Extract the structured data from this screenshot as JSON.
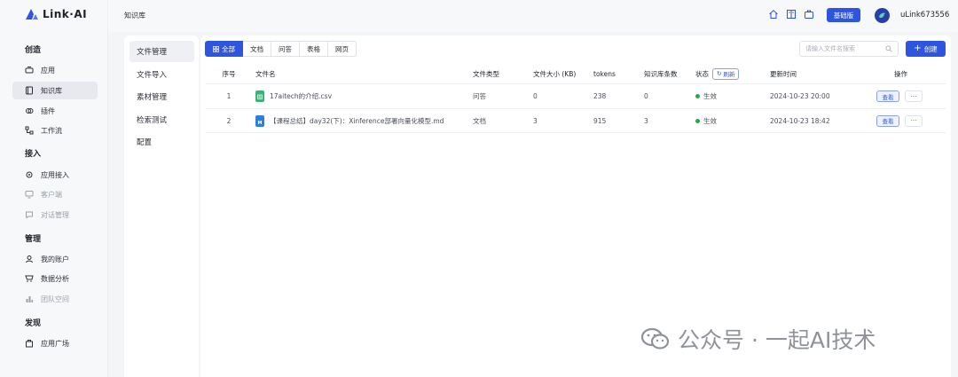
{
  "app": {
    "brand": "Link·AI"
  },
  "sidebar": {
    "groups": [
      {
        "title": "创造",
        "items": [
          {
            "label": "应用",
            "icon": "app-icon"
          },
          {
            "label": "知识库",
            "icon": "book-icon",
            "active": true
          },
          {
            "label": "插件",
            "icon": "plugin-icon"
          },
          {
            "label": "工作流",
            "icon": "workflow-icon"
          }
        ]
      },
      {
        "title": "接入",
        "items": [
          {
            "label": "应用接入",
            "icon": "access-icon"
          },
          {
            "label": "客户端",
            "icon": "monitor-icon",
            "muted": true
          },
          {
            "label": "对话管理",
            "icon": "chat-icon",
            "muted": true
          }
        ]
      },
      {
        "title": "管理",
        "items": [
          {
            "label": "我的账户",
            "icon": "user-icon"
          },
          {
            "label": "数据分析",
            "icon": "chart-icon"
          },
          {
            "label": "团队空间",
            "icon": "team-icon",
            "muted": true
          }
        ]
      },
      {
        "title": "发现",
        "items": [
          {
            "label": "应用广场",
            "icon": "store-icon"
          }
        ]
      }
    ]
  },
  "topbar": {
    "breadcrumb": "知识库",
    "plan": "基础版",
    "username": "uLink673556"
  },
  "submenu": [
    "文件管理",
    "文件导入",
    "素材管理",
    "检索测试",
    "配置"
  ],
  "filters": {
    "all": "全部",
    "tabs": [
      "文档",
      "问答",
      "表格",
      "网页"
    ]
  },
  "search": {
    "placeholder": "请输入文件名搜索"
  },
  "create_label": "创建",
  "table": {
    "headers": {
      "seq": "序号",
      "name": "文件名",
      "type": "文件类型",
      "size": "文件大小 (KB)",
      "tokens": "tokens",
      "kb_count": "知识库条数",
      "status": "状态",
      "refresh": "刷新",
      "updated": "更新时间",
      "ops": "操作"
    },
    "rows": [
      {
        "seq": "1",
        "name": "17aitech的介绍.csv",
        "icon": "csv-file-icon",
        "type": "问答",
        "size": "0",
        "tokens": "238",
        "kb_count": "0",
        "status": "生效",
        "updated": "2024-10-23 20:00",
        "view": "查看",
        "more": "···"
      },
      {
        "seq": "2",
        "name": "【课程总结】day32(下)：Xinference部署向量化模型.md",
        "icon": "md-file-icon",
        "type": "文档",
        "size": "3",
        "tokens": "915",
        "kb_count": "3",
        "status": "生效",
        "updated": "2024-10-23 18:42",
        "view": "查看",
        "more": "···"
      }
    ]
  },
  "watermark": "公众号 · 一起AI技术",
  "colors": {
    "primary": "#2d55e0",
    "active_status": "#28a745"
  }
}
